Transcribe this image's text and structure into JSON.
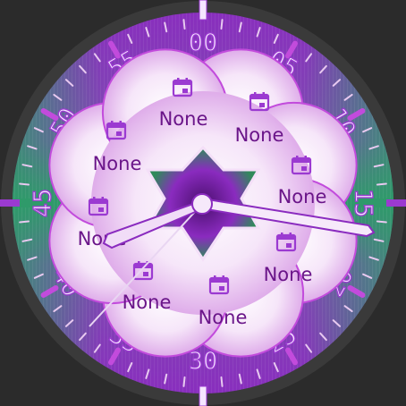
{
  "watch_face": {
    "minute_numbers": [
      "00",
      "05",
      "10",
      "15",
      "20",
      "25",
      "30",
      "35",
      "40",
      "45",
      "50",
      "55"
    ],
    "complications": [
      {
        "label": "None",
        "icon": "calendar-icon"
      },
      {
        "label": "None",
        "icon": "calendar-icon"
      },
      {
        "label": "None",
        "icon": "calendar-icon"
      },
      {
        "label": "None",
        "icon": "calendar-icon"
      },
      {
        "label": "None",
        "icon": "calendar-icon"
      },
      {
        "label": "None",
        "icon": "calendar-icon"
      },
      {
        "label": "None",
        "icon": "calendar-icon"
      },
      {
        "label": "None",
        "icon": "calendar-icon"
      }
    ],
    "colors": {
      "bezel": "#3a3a3a",
      "purple": "#8a2bbf",
      "green": "#2f9a6a",
      "accent_magenta": "#c24bdc",
      "label": "#6a1589",
      "hands": "#f3dff7"
    }
  }
}
